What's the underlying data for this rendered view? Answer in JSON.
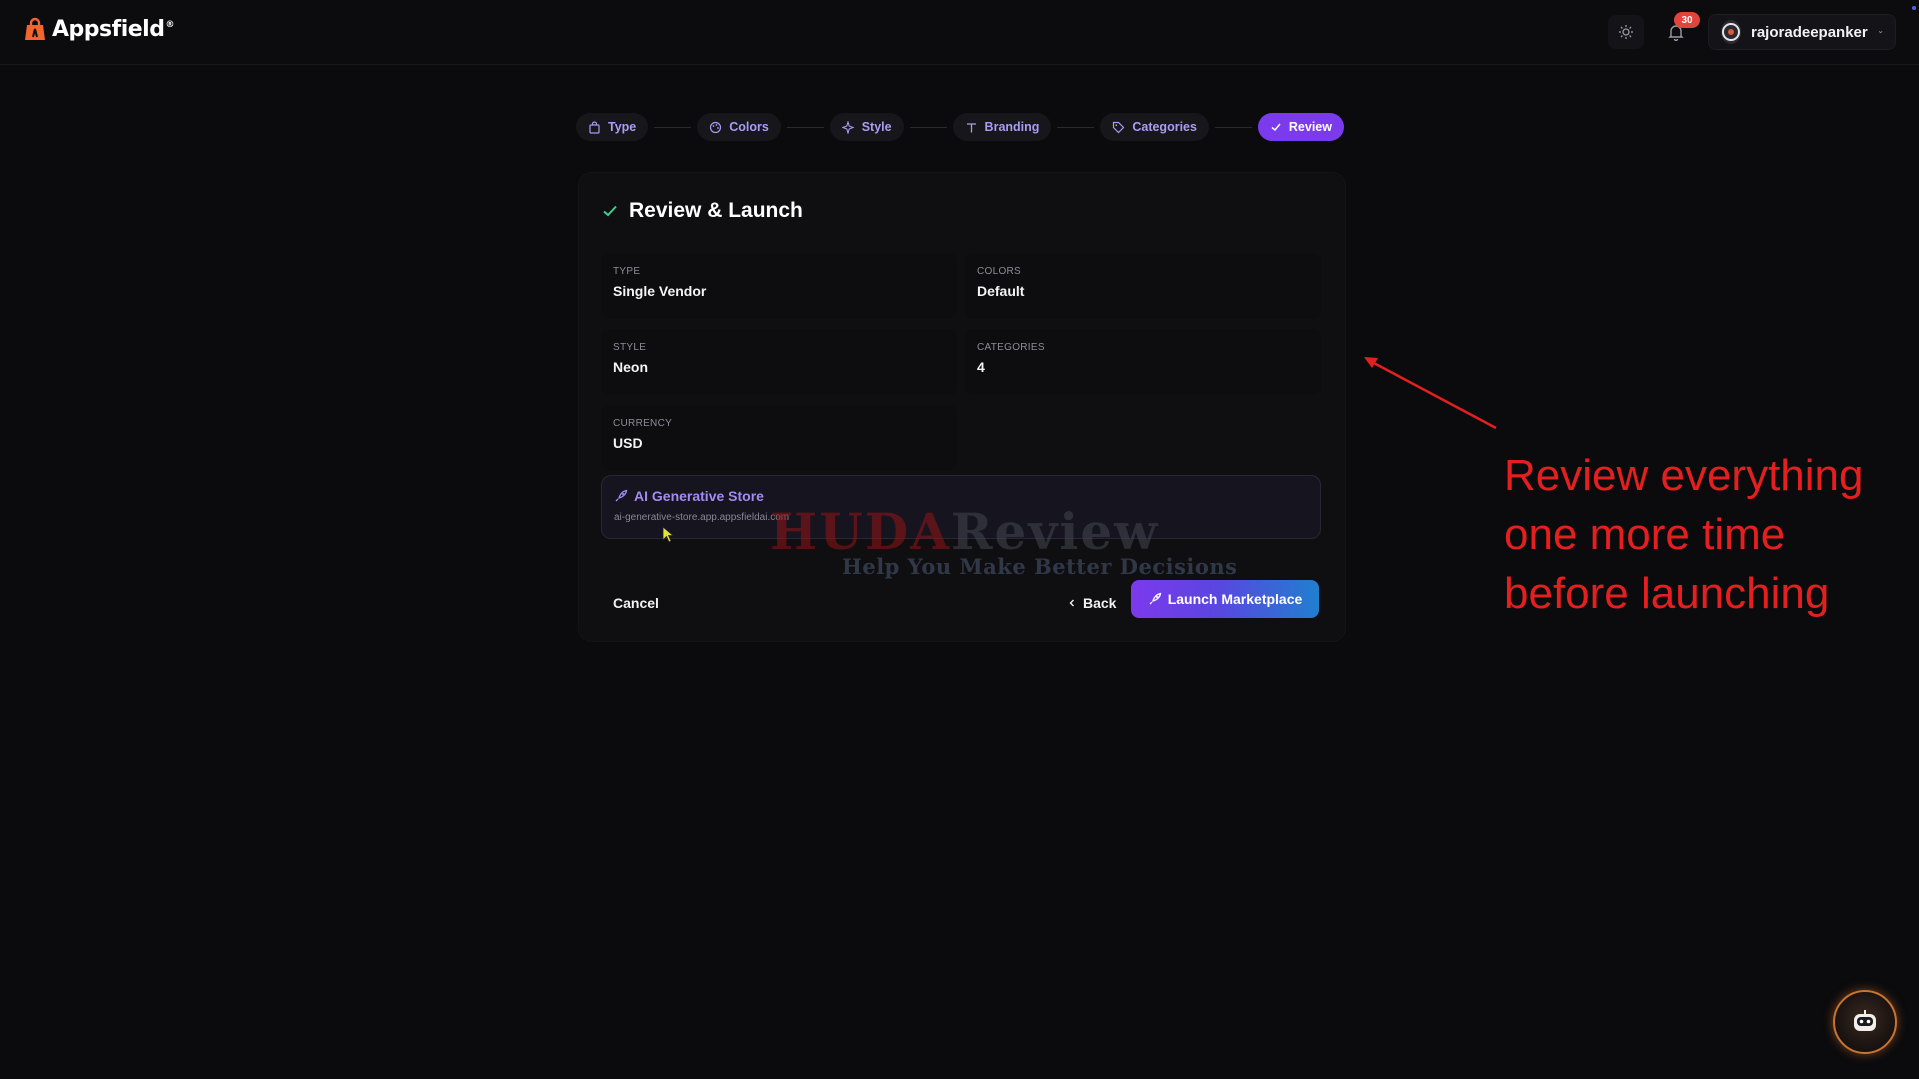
{
  "header": {
    "logo_text": "Appsfield",
    "logo_superscript": "®",
    "notification_count": "30",
    "username": "rajoradeepanker"
  },
  "stepper": {
    "steps": [
      {
        "label": "Type",
        "icon": "bag-icon",
        "active": false
      },
      {
        "label": "Colors",
        "icon": "palette-icon",
        "active": false
      },
      {
        "label": "Style",
        "icon": "sparkles-icon",
        "active": false
      },
      {
        "label": "Branding",
        "icon": "type-icon",
        "active": false
      },
      {
        "label": "Categories",
        "icon": "tag-icon",
        "active": false
      },
      {
        "label": "Review",
        "icon": "check-icon",
        "active": true
      }
    ]
  },
  "review": {
    "title": "Review & Launch",
    "fields": {
      "type": {
        "label": "TYPE",
        "value": "Single Vendor"
      },
      "colors": {
        "label": "COLORS",
        "value": "Default"
      },
      "style": {
        "label": "STYLE",
        "value": "Neon"
      },
      "categories": {
        "label": "CATEGORIES",
        "value": "4"
      },
      "currency": {
        "label": "CURRENCY",
        "value": "USD"
      }
    },
    "store": {
      "name": "AI Generative Store",
      "url": "ai-generative-store.app.appsfieldai.com"
    },
    "actions": {
      "cancel": "Cancel",
      "back": "Back",
      "launch": "Launch Marketplace"
    }
  },
  "watermark": {
    "title_part1": "HUDA",
    "title_part2": "Review",
    "subtitle": "Help You Make Better Decisions"
  },
  "annotation": {
    "text_line1": "Review everything",
    "text_line2": "one more time",
    "text_line3": "before launching"
  },
  "colors": {
    "accent": "#7c3aed",
    "background": "#0b0b0d",
    "annotation_red": "#e41f1f",
    "link_purple": "#a48bf4"
  }
}
